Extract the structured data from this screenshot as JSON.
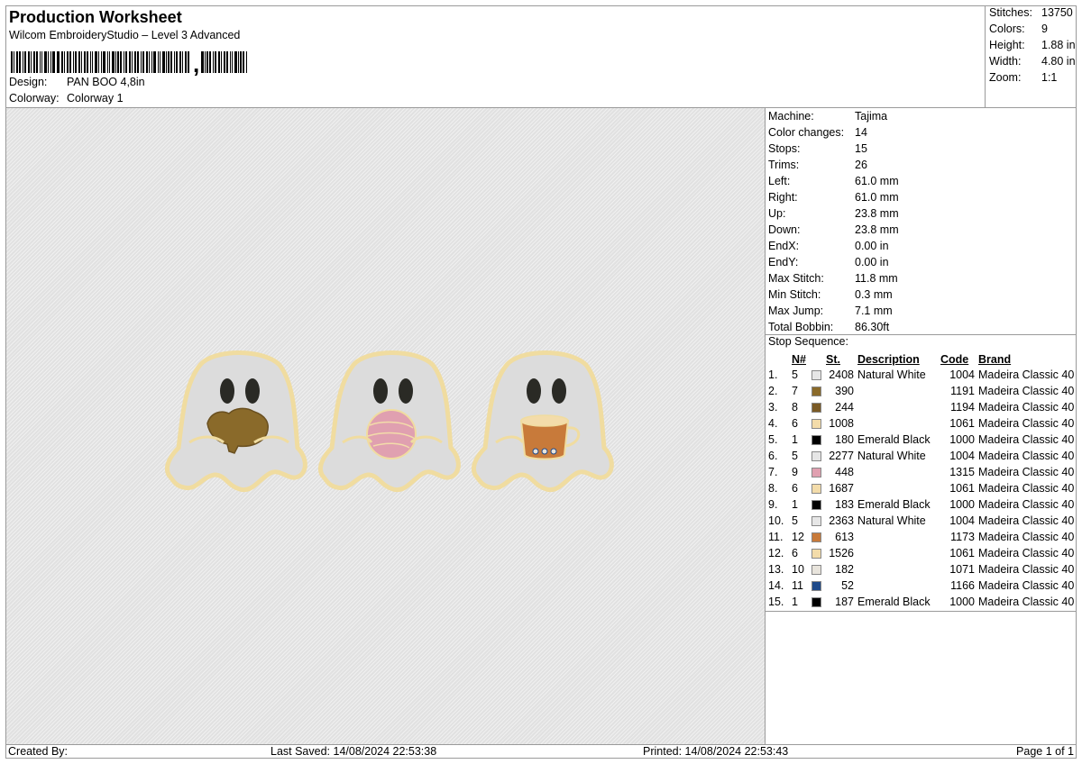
{
  "header": {
    "title": "Production Worksheet",
    "subtitle": "Wilcom EmbroideryStudio – Level 3 Advanced",
    "design_label": "Design:",
    "design_value": "PAN BOO 4,8in",
    "colorway_label": "Colorway:",
    "colorway_value": "Colorway 1"
  },
  "stats": [
    {
      "label": "Stitches:",
      "value": "13750"
    },
    {
      "label": "Colors:",
      "value": "9"
    },
    {
      "label": "Height:",
      "value": "1.88 in"
    },
    {
      "label": "Width:",
      "value": "4.80 in"
    },
    {
      "label": "Zoom:",
      "value": "1:1"
    }
  ],
  "properties": [
    {
      "label": "Machine:",
      "value": "Tajima"
    },
    {
      "label": "Color changes:",
      "value": "14"
    },
    {
      "label": "Stops:",
      "value": "15"
    },
    {
      "label": "Trims:",
      "value": "26"
    },
    {
      "label": "Left:",
      "value": "61.0 mm"
    },
    {
      "label": "Right:",
      "value": "61.0 mm"
    },
    {
      "label": "Up:",
      "value": "23.8 mm"
    },
    {
      "label": "Down:",
      "value": "23.8 mm"
    },
    {
      "label": "EndX:",
      "value": "0.00 in"
    },
    {
      "label": "EndY:",
      "value": "0.00 in"
    },
    {
      "label": "Max Stitch:",
      "value": "11.8 mm"
    },
    {
      "label": "Min Stitch:",
      "value": "0.3 mm"
    },
    {
      "label": "Max Jump:",
      "value": "7.1 mm"
    },
    {
      "label": "Total Bobbin:",
      "value": "86.30ft"
    }
  ],
  "stop_sequence": {
    "label": "Stop Sequence:",
    "headers": [
      "N#",
      "St.",
      "Description",
      "Code",
      "Brand"
    ],
    "rows": [
      {
        "idx": "1.",
        "n": "5",
        "color": "#e6e6e6",
        "st": "2408",
        "desc": "Natural White",
        "code": "1004",
        "brand": "Madeira Classic 40"
      },
      {
        "idx": "2.",
        "n": "7",
        "color": "#8a6a2a",
        "st": "390",
        "desc": "",
        "code": "1191",
        "brand": "Madeira Classic 40"
      },
      {
        "idx": "3.",
        "n": "8",
        "color": "#7a5a25",
        "st": "244",
        "desc": "",
        "code": "1194",
        "brand": "Madeira Classic 40"
      },
      {
        "idx": "4.",
        "n": "6",
        "color": "#f3dcaa",
        "st": "1008",
        "desc": "",
        "code": "1061",
        "brand": "Madeira Classic 40"
      },
      {
        "idx": "5.",
        "n": "1",
        "color": "#000000",
        "st": "180",
        "desc": "Emerald Black",
        "code": "1000",
        "brand": "Madeira Classic 40"
      },
      {
        "idx": "6.",
        "n": "5",
        "color": "#e6e6e6",
        "st": "2277",
        "desc": "Natural White",
        "code": "1004",
        "brand": "Madeira Classic 40"
      },
      {
        "idx": "7.",
        "n": "9",
        "color": "#e0a0b0",
        "st": "448",
        "desc": "",
        "code": "1315",
        "brand": "Madeira Classic 40"
      },
      {
        "idx": "8.",
        "n": "6",
        "color": "#f3dcaa",
        "st": "1687",
        "desc": "",
        "code": "1061",
        "brand": "Madeira Classic 40"
      },
      {
        "idx": "9.",
        "n": "1",
        "color": "#000000",
        "st": "183",
        "desc": "Emerald Black",
        "code": "1000",
        "brand": "Madeira Classic 40"
      },
      {
        "idx": "10.",
        "n": "5",
        "color": "#e6e6e6",
        "st": "2363",
        "desc": "Natural White",
        "code": "1004",
        "brand": "Madeira Classic 40"
      },
      {
        "idx": "11.",
        "n": "12",
        "color": "#c87a3a",
        "st": "613",
        "desc": "",
        "code": "1173",
        "brand": "Madeira Classic 40"
      },
      {
        "idx": "12.",
        "n": "6",
        "color": "#f3dcaa",
        "st": "1526",
        "desc": "",
        "code": "1061",
        "brand": "Madeira Classic 40"
      },
      {
        "idx": "13.",
        "n": "10",
        "color": "#e8e4dc",
        "st": "182",
        "desc": "",
        "code": "1071",
        "brand": "Madeira Classic 40"
      },
      {
        "idx": "14.",
        "n": "11",
        "color": "#1f4a8a",
        "st": "52",
        "desc": "",
        "code": "1166",
        "brand": "Madeira Classic 40"
      },
      {
        "idx": "15.",
        "n": "1",
        "color": "#000000",
        "st": "187",
        "desc": "Emerald Black",
        "code": "1000",
        "brand": "Madeira Classic 40"
      }
    ]
  },
  "footer": {
    "created_by": "Created By:",
    "last_saved": "Last Saved: 14/08/2024 22:53:38",
    "printed": "Printed: 14/08/2024 22:53:43",
    "page": "Page 1 of 1"
  },
  "artwork": {
    "ghosts": [
      "ghost-with-pig",
      "ghost-with-yarn-ball",
      "ghost-with-coffee-cup"
    ],
    "outline_color": "#f0dca0",
    "fill_color": "#dcdcdc",
    "eye_color": "#2a2a25"
  }
}
